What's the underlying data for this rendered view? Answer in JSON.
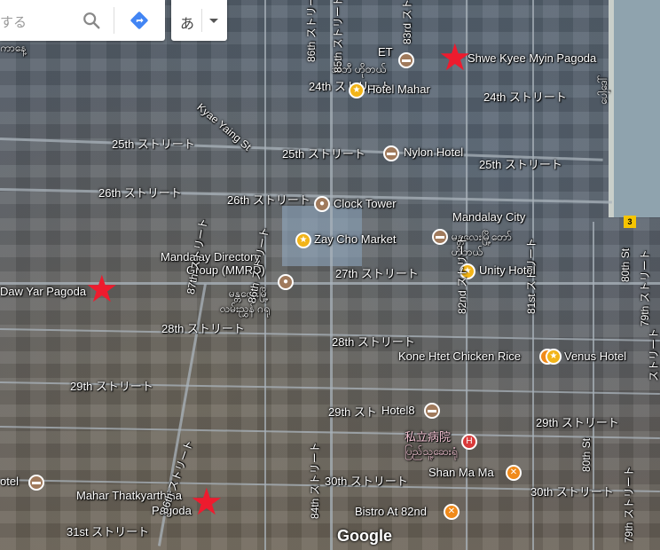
{
  "search": {
    "text": "する"
  },
  "language_button": {
    "label": "あ"
  },
  "attribution": "Google",
  "highway_shield": "3",
  "labels": {
    "top_left_script": "ကာနေ့",
    "et": "ET",
    "hotel_myanmar_top": "အီတီ ဟိုတယ်",
    "shwe_kyee_myin": "Shwe Kyee Myin Pagoda",
    "st24": "24th ストリート",
    "hotel_mahar": "Hotel Mahar",
    "st24_right": "24th ストリート",
    "kyae_yaing": "Kyae Yaing St",
    "st25_left": "25th ストリート",
    "st25_mid": "25th ストリート",
    "nylon_hotel": "Nylon Hotel",
    "st25_right": "25th ストリート",
    "st26_left": "26th ストリート",
    "st26_mid": "26th ストリート",
    "clock_tower": "Clock Tower",
    "mandalay_city": "Mandalay City",
    "mandalay_city_my": "မန္တလေးမြို့တော်",
    "mandalay_city_my2": "ဟိုတယ်",
    "zay_cho": "Zay Cho Market",
    "mandalay_directory_1": "Mandalay Directory",
    "mandalay_directory_2": "Group (MMRD)",
    "myanmar_mid1": "မန္တလေးမြို့",
    "myanmar_mid2": "လမ်းညွှန် ဂရု",
    "st27": "27th ストリート",
    "unity_hotel": "Unity Hotel",
    "daw_yar": "Daw Yar Pagoda",
    "st28_left": "28th ストリート",
    "st28_mid": "28th ストリート",
    "kone_htet": "Kone Htet Chicken Rice",
    "venus_hotel": "Venus Hotel",
    "st29_left": "29th ストリート",
    "st29_mid": "29th スト",
    "hotel8": "Hotel8",
    "private_hospital": "私立病院",
    "hospital_my": "ပြည်သူ့ဆေးရုံ",
    "st29_right": "29th ストリート",
    "hotel_left": "otel",
    "st30_mid": "30th ストリート",
    "shan_ma_ma": "Shan Ma Ma",
    "st30_right": "30th ストリート",
    "mahar_1": "Mahar Thatkyarthiha",
    "mahar_2": "Pagoda",
    "bistro": "Bistro At 82nd",
    "st31": "31st ストリート",
    "st86_top": "86th ストリート",
    "st85_top": "85th ストリート",
    "st87": "87th ストリート",
    "st86_mid": "86th ストリート",
    "st86_bot": "86th ストリート",
    "st84": "84th ストリート",
    "st82": "82nd ストリート",
    "st81": "81st ストリート",
    "st80_top": "80th St",
    "st80_bot": "80th St",
    "st79_top": "79th ストリート",
    "st79_bot": "79th ストリート",
    "st78_bot": "ストリート",
    "right_script": "ပေါ့ဒေါ်",
    "top_vertical": "ストリート",
    "st83_top": "83rd ストリート"
  },
  "pins": {
    "hotel": "★",
    "clock": "●",
    "restaurant": "🍴",
    "hospital": "H",
    "bed": "▬"
  },
  "colors": {
    "gold_pin": "#f2b418",
    "brown_pin": "#a07a5c",
    "orange_pin": "#f08a1a",
    "hospital_pin": "#d93a3a",
    "pagoda_star": "#ee1b2e",
    "direction_blue": "#4285f4"
  }
}
